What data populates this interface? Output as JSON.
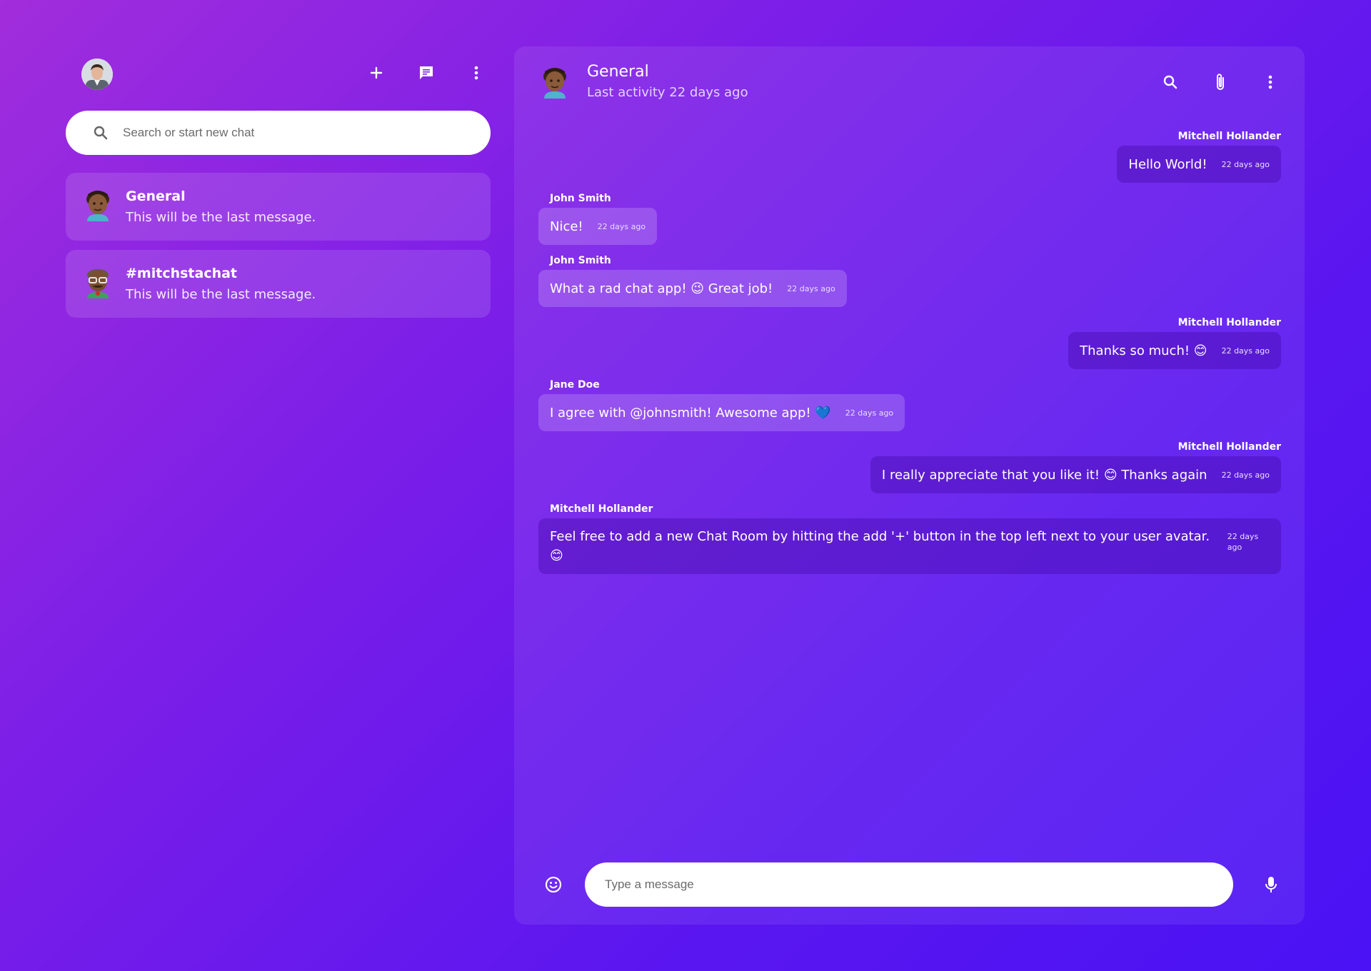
{
  "sidebar": {
    "search_placeholder": "Search or start new chat",
    "rooms": [
      {
        "name": "General",
        "last_message": "This will be the last message.",
        "avatar": "afro-boy-avatar"
      },
      {
        "name": "#mitchstachat",
        "last_message": "This will be the last message.",
        "avatar": "glasses-mustache-avatar"
      }
    ]
  },
  "chat": {
    "title": "General",
    "subtitle": "Last activity 22 days ago",
    "messages": [
      {
        "author": "Mitchell Hollander",
        "text": "Hello World!",
        "time": "22 days ago",
        "side": "mine"
      },
      {
        "author": "John Smith",
        "text": "Nice!",
        "time": "22 days ago",
        "side": "theirs"
      },
      {
        "author": "John Smith",
        "text": "What a rad chat app! 😉 Great job!",
        "time": "22 days ago",
        "side": "theirs"
      },
      {
        "author": "Mitchell Hollander",
        "text": "Thanks so much! 😊",
        "time": "22 days ago",
        "side": "mine"
      },
      {
        "author": "Jane Doe",
        "text": "I agree with @johnsmith! Awesome app! 💙",
        "time": "22 days ago",
        "side": "theirs"
      },
      {
        "author": "Mitchell Hollander",
        "text": "I really appreciate that you like it! 😊 Thanks again",
        "time": "22 days ago",
        "side": "mine"
      },
      {
        "author": "Mitchell Hollander",
        "text": "Feel free to add a new Chat Room by hitting the add '+' button in the top left next to your user avatar. 😊",
        "time": "22 days ago",
        "side": "theirs"
      }
    ],
    "composer_placeholder": "Type a message"
  },
  "colors": {
    "bg_start": "#a12ddc",
    "bg_end": "#4a12f4"
  }
}
